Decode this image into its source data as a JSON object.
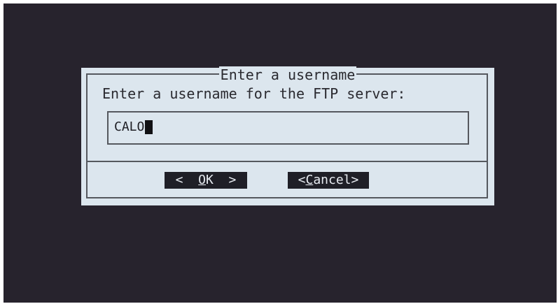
{
  "dialog": {
    "title": "Enter a username",
    "prompt": "Enter a username for the FTP server:",
    "input": {
      "value": "CALO"
    },
    "buttons": {
      "ok": {
        "left": "<  ",
        "hotkey": "O",
        "rest": "K  >"
      },
      "cancel": {
        "left": "<",
        "hotkey": "C",
        "rest": "ancel>"
      }
    }
  },
  "colors": {
    "background": "#27232d",
    "dialog": "#dce6ee",
    "button_bg": "#1f1f27",
    "button_fg": "#e8ecf2"
  }
}
